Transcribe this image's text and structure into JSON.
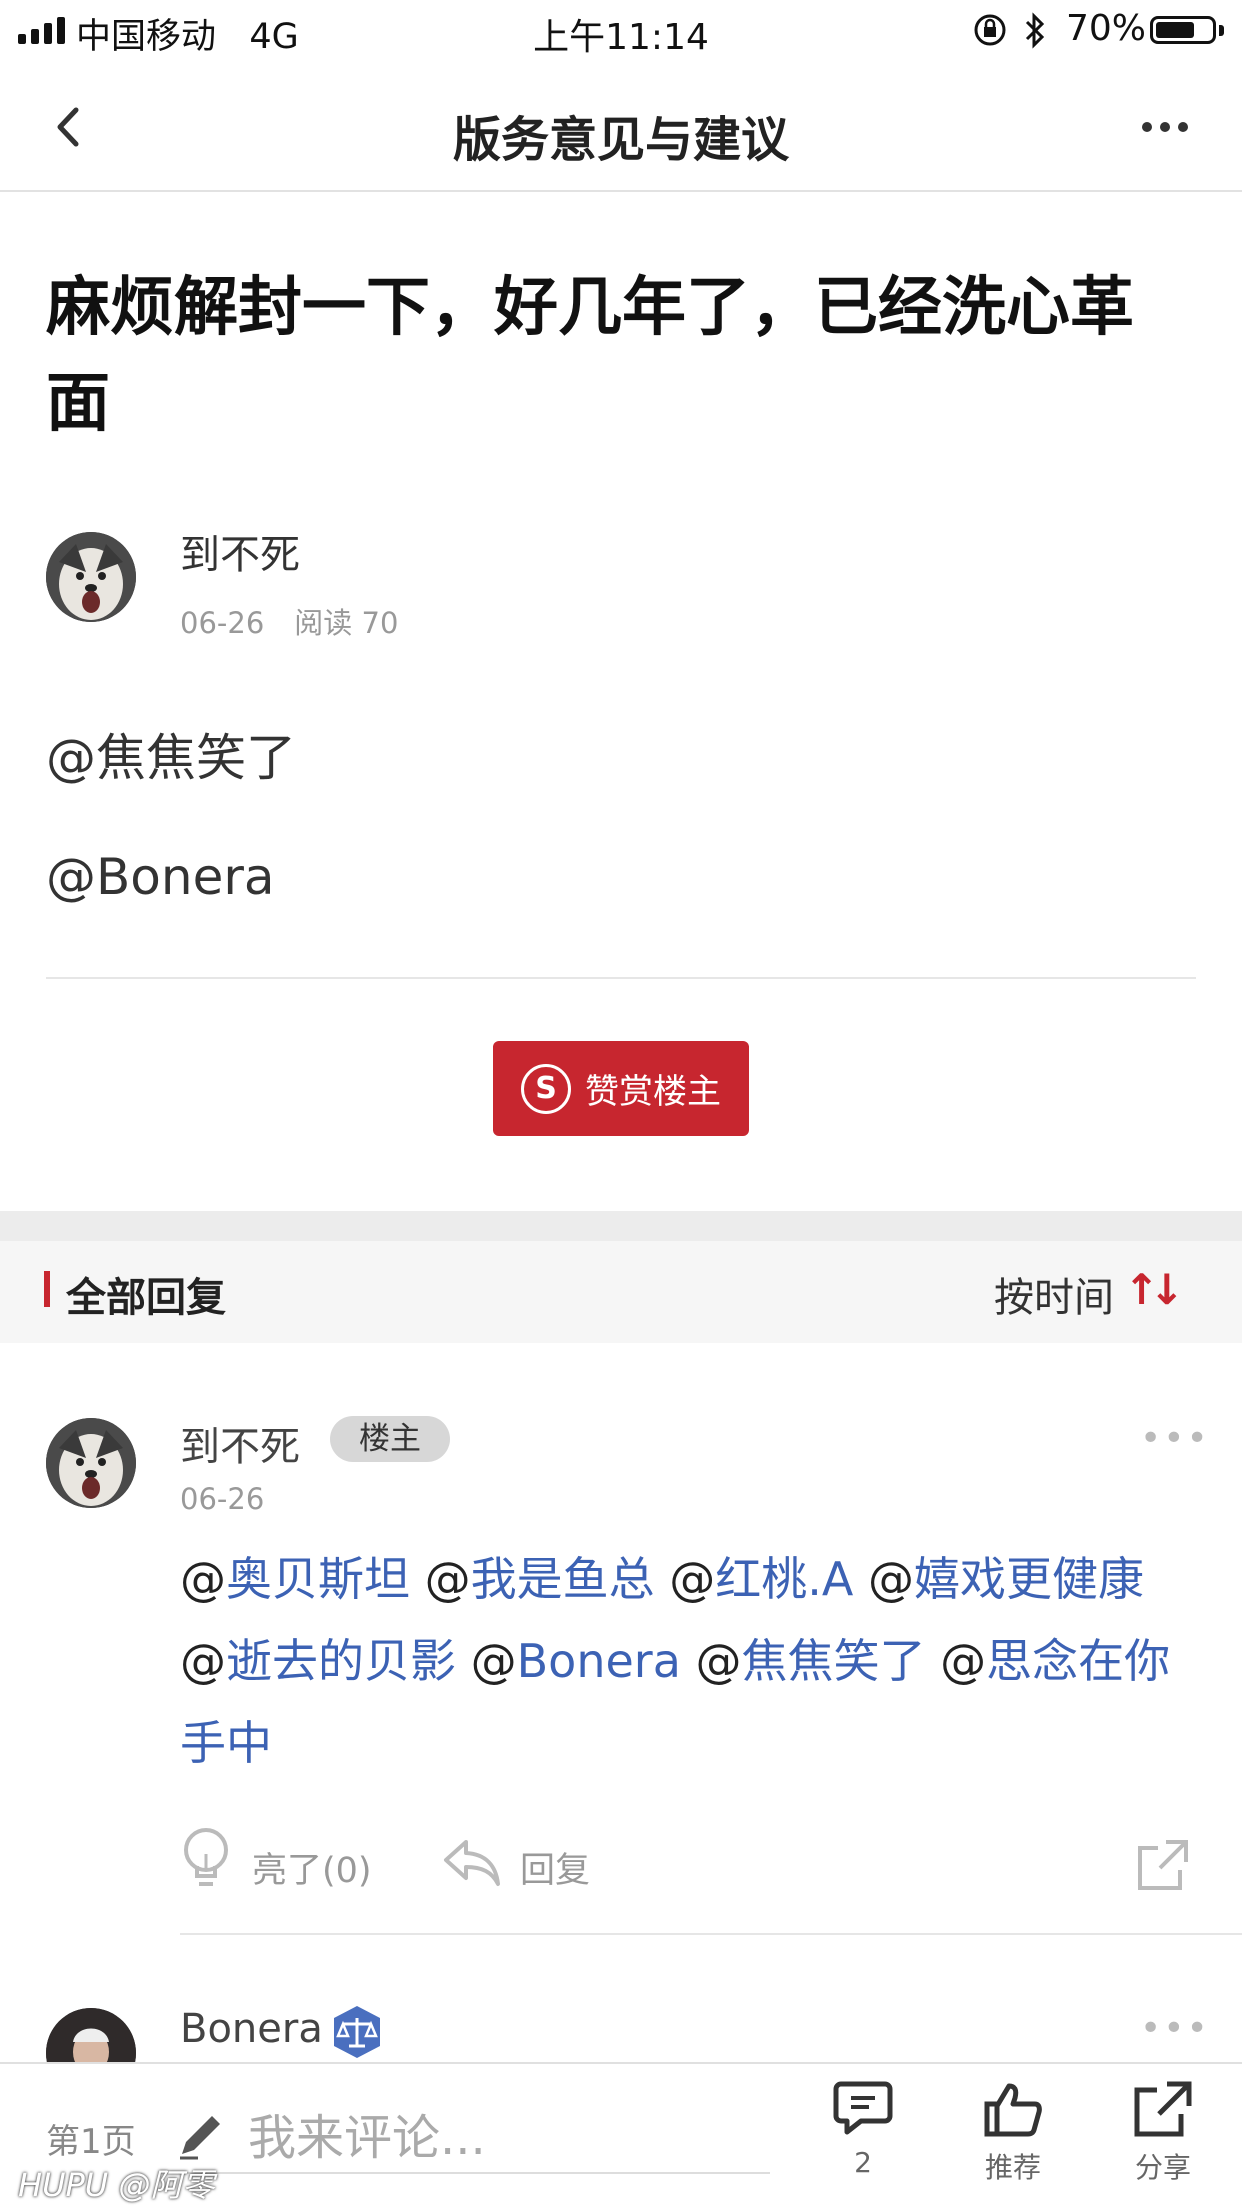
{
  "status_bar": {
    "carrier": "中国移动",
    "network": "4G",
    "time": "上午11:14",
    "battery": "70%",
    "battery_level": 0.7
  },
  "nav": {
    "title": "版务意见与建议"
  },
  "post": {
    "title": "麻烦解封一下，好几年了，已经洗心革面",
    "author": "到不死",
    "date": "06-26",
    "reads": "阅读 70",
    "body_lines": [
      "@焦焦笑了",
      "@Bonera"
    ],
    "reward_label": "赞赏楼主",
    "reward_icon": "S"
  },
  "replies_header": {
    "label": "全部回复",
    "sort_label": "按时间",
    "sort_icon": "↑↓"
  },
  "replies": [
    {
      "author": "到不死",
      "badge": "楼主",
      "date": "06-26",
      "mentions": [
        "奥贝斯坦",
        "我是鱼总",
        "红桃.A",
        "嬉戏更健康",
        "逝去的贝影",
        "Bonera",
        "焦焦笑了",
        "思念在你手中"
      ],
      "light_label": "亮了(0)",
      "reply_label": "回复"
    },
    {
      "author": "Bonera"
    }
  ],
  "bottom_bar": {
    "page_label": "第1页",
    "comment_placeholder": "我来评论...",
    "comment_count": "2",
    "recommend_label": "推荐",
    "share_label": "分享"
  },
  "watermark": "HUPU @阿零",
  "colors": {
    "accent_red": "#c7262f",
    "link_blue": "#3c62b4"
  }
}
